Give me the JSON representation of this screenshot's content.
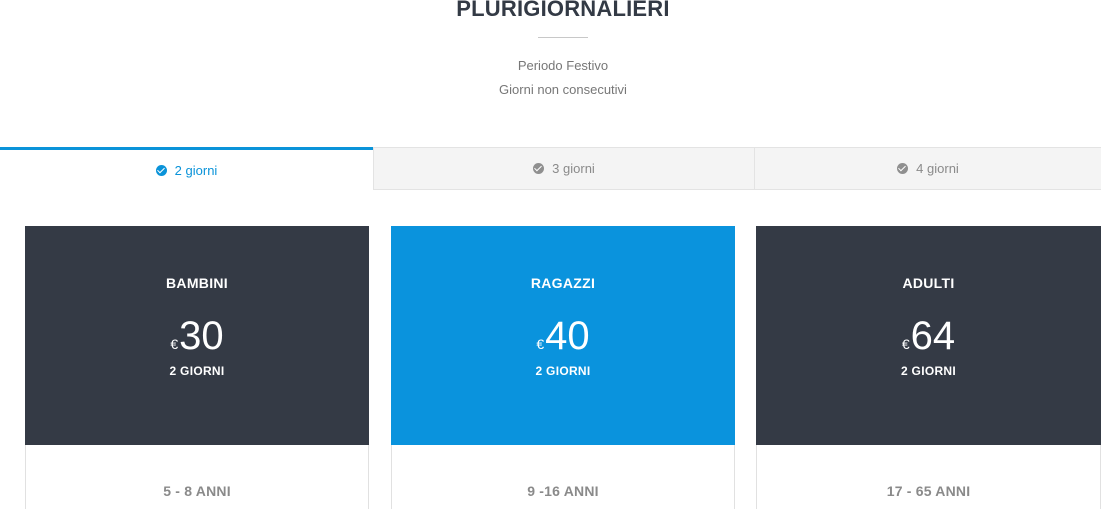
{
  "header": {
    "title": "PLURIGIORNALIERI",
    "subtitle_lines": [
      "Periodo Festivo",
      "Giorni non consecutivi"
    ]
  },
  "tabs": [
    {
      "label": "2 giorni",
      "active": true,
      "icon": "check-circle-icon"
    },
    {
      "label": "3 giorni",
      "active": false,
      "icon": "check-circle-icon"
    },
    {
      "label": "4 giorni",
      "active": false,
      "icon": "check-circle-icon"
    }
  ],
  "cards": [
    {
      "name": "BAMBINI",
      "currency": "€",
      "price": "30",
      "duration": "2 GIORNI",
      "age": "5 - 8 ANNI",
      "color": "#343a45"
    },
    {
      "name": "RAGAZZI",
      "currency": "€",
      "price": "40",
      "duration": "2 GIORNI",
      "age": "9 -16 ANNI",
      "color": "#0a93dd"
    },
    {
      "name": "ADULTI",
      "currency": "€",
      "price": "64",
      "duration": "2 GIORNI",
      "age": "17 - 65 ANNI",
      "color": "#343a45"
    }
  ],
  "colors": {
    "accent": "#0a93d9",
    "dark": "#343a45",
    "text_muted": "#8a8a8a"
  }
}
